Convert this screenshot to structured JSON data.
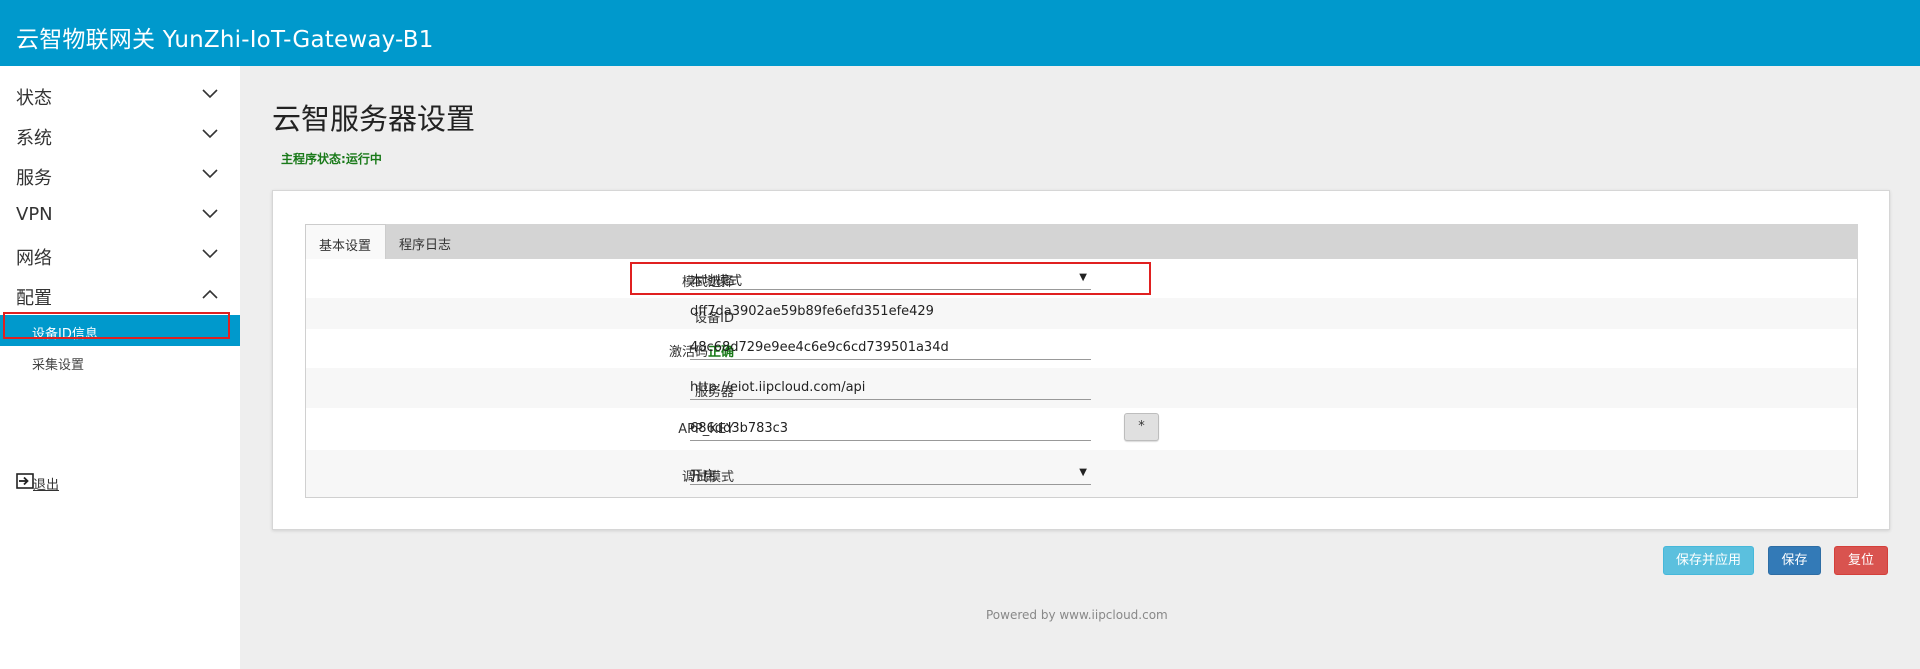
{
  "header": {
    "title": "云智物联网关 YunZhi-IoT-Gateway-B1"
  },
  "sidebar": {
    "items": [
      {
        "label": "状态",
        "icon": "chevron-down-icon"
      },
      {
        "label": "系统",
        "icon": "chevron-down-icon"
      },
      {
        "label": "服务",
        "icon": "chevron-down-icon"
      },
      {
        "label": "VPN",
        "icon": "chevron-down-icon"
      },
      {
        "label": "网络",
        "icon": "chevron-down-icon"
      },
      {
        "label": "配置",
        "icon": "chevron-up-icon"
      }
    ],
    "subitems": [
      {
        "label": "设备ID信息",
        "active": true
      },
      {
        "label": "采集设置",
        "active": false
      }
    ],
    "logout": {
      "label": "退出",
      "icon": "logout-icon"
    }
  },
  "main": {
    "title": "云智服务器设置",
    "status_label": "主程序状态:",
    "status_value": "运行中",
    "tabs": [
      {
        "label": "基本设置",
        "active": true
      },
      {
        "label": "程序日志",
        "active": false
      }
    ],
    "form": {
      "mode": {
        "label": "模式选择",
        "value": "本地模式"
      },
      "device_id": {
        "label": "设备ID",
        "value": "dff7da3902ae59b89fe6efd351efe429"
      },
      "activation": {
        "label": "激活码",
        "status": "正确",
        "value": "48c68d729e9ee4c6e9c6cd739501a34d"
      },
      "server": {
        "label": "服务器",
        "value": "http://eiot.iipcloud.com/api"
      },
      "app_key": {
        "label": "APP_KEY",
        "value": "686dd3b783c3",
        "reveal_button": "*"
      },
      "debug": {
        "label": "调试模式",
        "value": "开启"
      }
    },
    "buttons": {
      "save_apply": "保存并应用",
      "save": "保存",
      "reset": "复位"
    }
  },
  "footer": {
    "text": "Powered by www.iipcloud.com"
  },
  "colors": {
    "header": "#0099cc",
    "status_ok": "#1a7a1a",
    "highlight": "#e02020",
    "apply": "#5bc0de",
    "save": "#337ab7",
    "reset": "#d9534f"
  }
}
